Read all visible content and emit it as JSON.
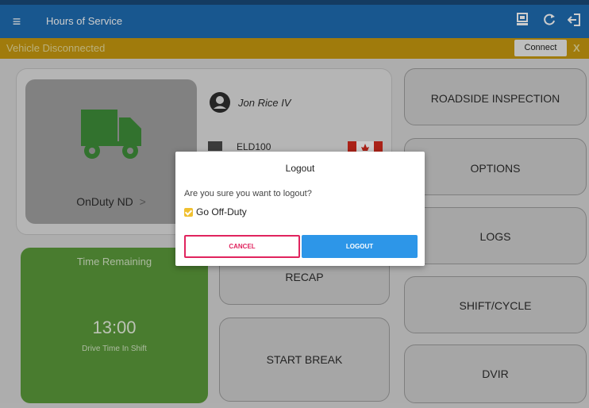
{
  "appbar": {
    "title": "Hours of Service",
    "menu_icon": "≡",
    "icons": [
      "eld-device-icon",
      "refresh-icon",
      "logout-icon"
    ]
  },
  "banner": {
    "message": "Vehicle Disconnected",
    "connect_label": "Connect",
    "close_label": "X",
    "color": "#c99a0f"
  },
  "status_card": {
    "status_label": "OnDuty ND",
    "chevron": ">",
    "driver_name": "Jon Rice IV",
    "eld_label": "ELD100"
  },
  "time_card": {
    "title": "Time Remaining",
    "value": "13:00",
    "caption": "Drive Time In Shift",
    "color": "#5c9c3b"
  },
  "middle_buttons": {
    "recap": "RECAP",
    "start_break": "START BREAK"
  },
  "right_buttons": [
    {
      "label": "ROADSIDE INSPECTION"
    },
    {
      "label": "OPTIONS"
    },
    {
      "label": "LOGS"
    },
    {
      "label": "SHIFT/CYCLE"
    },
    {
      "label": "DVIR"
    }
  ],
  "dialog": {
    "title": "Logout",
    "message": "Are you sure you want to logout?",
    "checkbox_label": "Go Off-Duty",
    "checkbox_checked": true,
    "cancel_label": "CANCEL",
    "logout_label": "LOGOUT",
    "cancel_color": "#e0245e",
    "logout_color": "#2d96e8"
  },
  "colors": {
    "appbar": "#1f6db3",
    "truck": "#3f8f3a"
  }
}
